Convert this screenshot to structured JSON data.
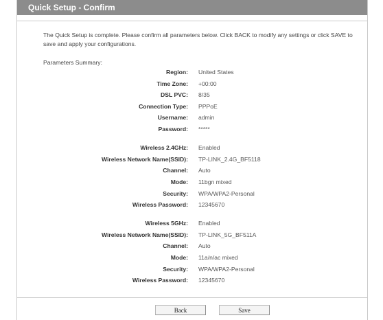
{
  "header": {
    "title": "Quick Setup - Confirm"
  },
  "intro_text": "The Quick Setup is complete. Please confirm all parameters below. Click BACK to modify any settings or click SAVE to save and apply your configurations.",
  "summary_label": "Parameters Summary:",
  "params": [
    {
      "label": "Region:",
      "value": "United States"
    },
    {
      "label": "Time Zone:",
      "value": "+00:00"
    },
    {
      "label": "DSL PVC:",
      "value": "8/35"
    },
    {
      "label": "Connection Type:",
      "value": "PPPoE"
    },
    {
      "label": "Username:",
      "value": "admin"
    },
    {
      "label": "Password:",
      "value": "*****"
    }
  ],
  "wireless_24": [
    {
      "label": "Wireless 2.4GHz:",
      "value": "Enabled"
    },
    {
      "label": "Wireless Network Name(SSID):",
      "value": "TP-LINK_2.4G_BF5118"
    },
    {
      "label": "Channel:",
      "value": "Auto"
    },
    {
      "label": "Mode:",
      "value": "11bgn mixed"
    },
    {
      "label": "Security:",
      "value": "WPA/WPA2-Personal"
    },
    {
      "label": "Wireless Password:",
      "value": "12345670"
    }
  ],
  "wireless_5": [
    {
      "label": "Wireless 5GHz:",
      "value": "Enabled"
    },
    {
      "label": "Wireless Network Name(SSID):",
      "value": "TP-LINK_5G_BF511A"
    },
    {
      "label": "Channel:",
      "value": "Auto"
    },
    {
      "label": "Mode:",
      "value": "11a/n/ac mixed"
    },
    {
      "label": "Security:",
      "value": "WPA/WPA2-Personal"
    },
    {
      "label": "Wireless Password:",
      "value": "12345670"
    }
  ],
  "buttons": {
    "back": "Back",
    "save": "Save"
  }
}
